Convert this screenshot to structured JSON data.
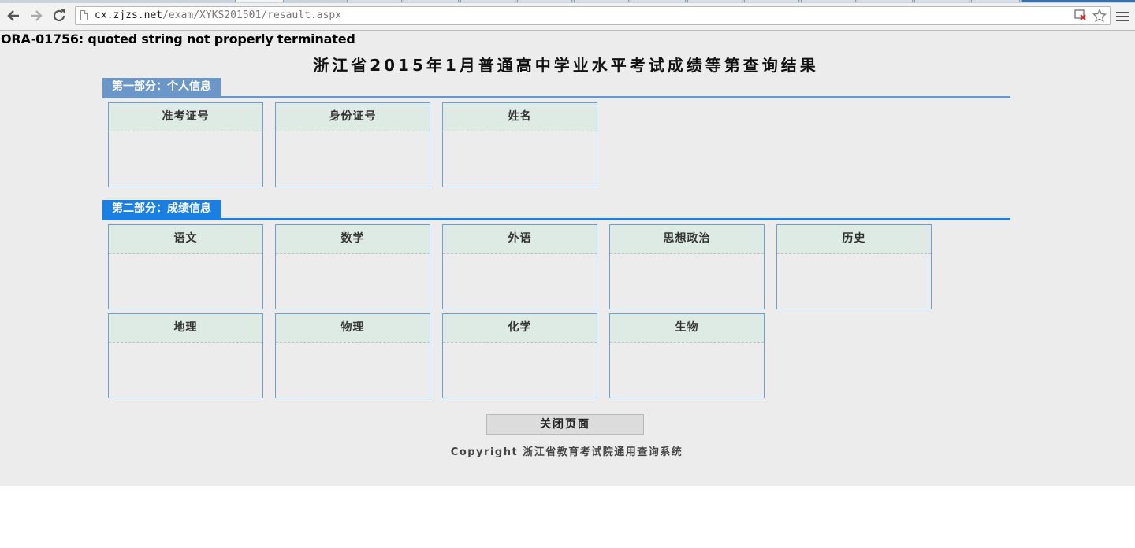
{
  "browser": {
    "url_host": "cx.zjzs.net",
    "url_path": "/exam/XYKS201501/resault.aspx",
    "icons": [
      "back-arrow-icon",
      "forward-arrow-icon",
      "reload-icon",
      "page-icon",
      "blocked-content-icon",
      "star-icon",
      "menu-icon"
    ]
  },
  "page": {
    "error_message": "ORA-01756: quoted string not properly terminated",
    "title": "浙江省2015年1月普通高中学业水平考试成绩等第查询结果",
    "section1": {
      "heading": "第一部分：个人信息",
      "fields": [
        "准考证号",
        "身份证号",
        "姓名"
      ]
    },
    "section2": {
      "heading": "第二部分：成绩信息",
      "row1": [
        "语文",
        "数学",
        "外语",
        "思想政治",
        "历史"
      ],
      "row2": [
        "地理",
        "物理",
        "化学",
        "生物"
      ]
    },
    "close_button_label": "关闭页面",
    "copyright": "Copyright 浙江省教育考试院通用查询系统"
  },
  "colors": {
    "section1_accent": "#6a97c8",
    "section2_accent": "#1a7fe0",
    "label_bg": "#deeae4",
    "page_bg": "#ececec"
  }
}
